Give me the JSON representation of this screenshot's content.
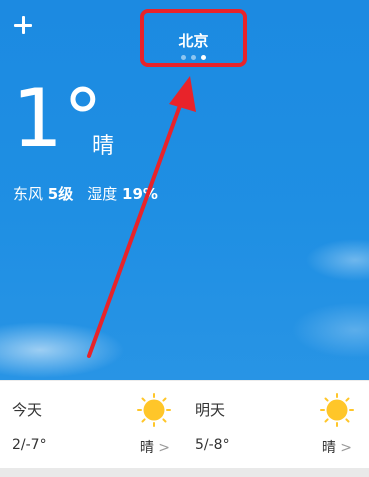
{
  "header": {
    "add_label": "+",
    "city": "北京",
    "page_count": 3,
    "active_page": 3
  },
  "current": {
    "temperature": "1°",
    "condition": "晴",
    "wind_label": "东风",
    "wind_value": "5级",
    "humidity_label": "湿度",
    "humidity_value": "19%"
  },
  "forecast": [
    {
      "day": "今天",
      "range": "2/-7°",
      "condition": "晴",
      "chevron": ">",
      "icon": "sun-icon"
    },
    {
      "day": "明天",
      "range": "5/-8°",
      "condition": "晴",
      "chevron": ">",
      "icon": "sun-icon"
    }
  ],
  "colors": {
    "sky": "#1f8fe0",
    "highlight": "#e8232a",
    "sun": "#ffc629"
  }
}
